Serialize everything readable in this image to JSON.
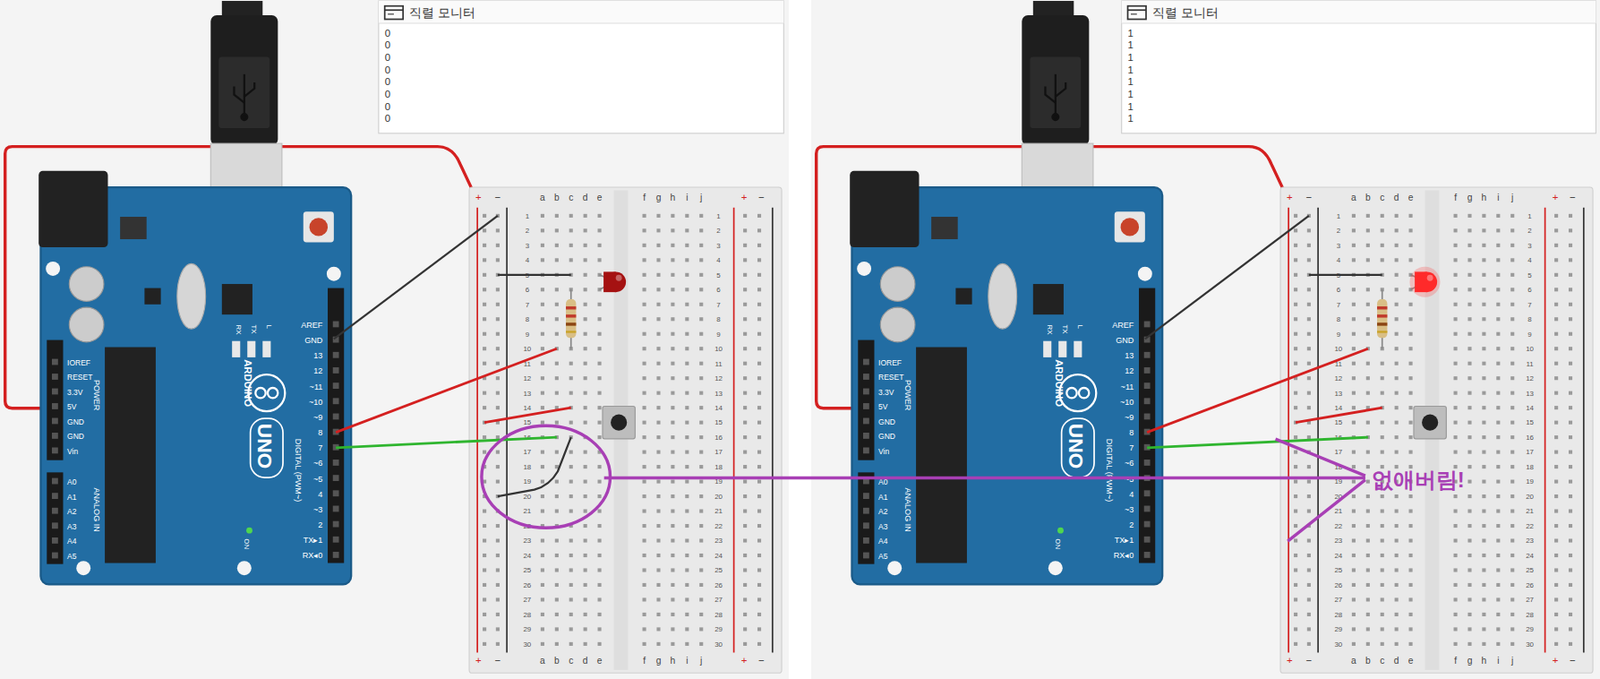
{
  "panels": [
    {
      "serial_monitor": {
        "title": "직렬 모니터",
        "lines": [
          "0",
          "0",
          "0",
          "0",
          "0",
          "0",
          "0",
          "0"
        ]
      },
      "led_on": false,
      "ground_wire_present": true
    },
    {
      "serial_monitor": {
        "title": "직렬 모니터",
        "lines": [
          "1",
          "1",
          "1",
          "1",
          "1",
          "1",
          "1",
          "1"
        ]
      },
      "led_on": true,
      "ground_wire_present": false
    }
  ],
  "annotation": {
    "label": "없애버림!"
  },
  "arduino": {
    "brand": "ARDUINO",
    "model": "UNO",
    "digital_label": "DIGITAL (PWM~)",
    "digital_pins": [
      "AREF",
      "GND",
      "13",
      "12",
      "~11",
      "~10",
      "~9",
      "8",
      "7",
      "~6",
      "~5",
      "4",
      "~3",
      "2",
      "TX▸1",
      "RX◂0"
    ],
    "power_label": "POWER",
    "power_pins": [
      "IOREF",
      "RESET",
      "3.3V",
      "5V",
      "GND",
      "GND",
      "Vin"
    ],
    "analog_label": "ANALOG IN",
    "analog_pins": [
      "A0",
      "A1",
      "A2",
      "A3",
      "A4",
      "A5"
    ],
    "status_leds": [
      "RX",
      "TX",
      "L"
    ],
    "on_label": "ON"
  },
  "breadboard": {
    "columns_left": [
      "a",
      "b",
      "c",
      "d",
      "e"
    ],
    "columns_right": [
      "f",
      "g",
      "h",
      "i",
      "j"
    ],
    "rows": [
      "1",
      "2",
      "3",
      "4",
      "5",
      "6",
      "7",
      "8",
      "9",
      "10",
      "11",
      "12",
      "13",
      "14",
      "15",
      "16",
      "17",
      "18",
      "19",
      "20",
      "21",
      "22",
      "23",
      "24",
      "25",
      "26",
      "27",
      "28",
      "29",
      "30"
    ],
    "rail_plus": "+",
    "rail_minus": "−"
  }
}
